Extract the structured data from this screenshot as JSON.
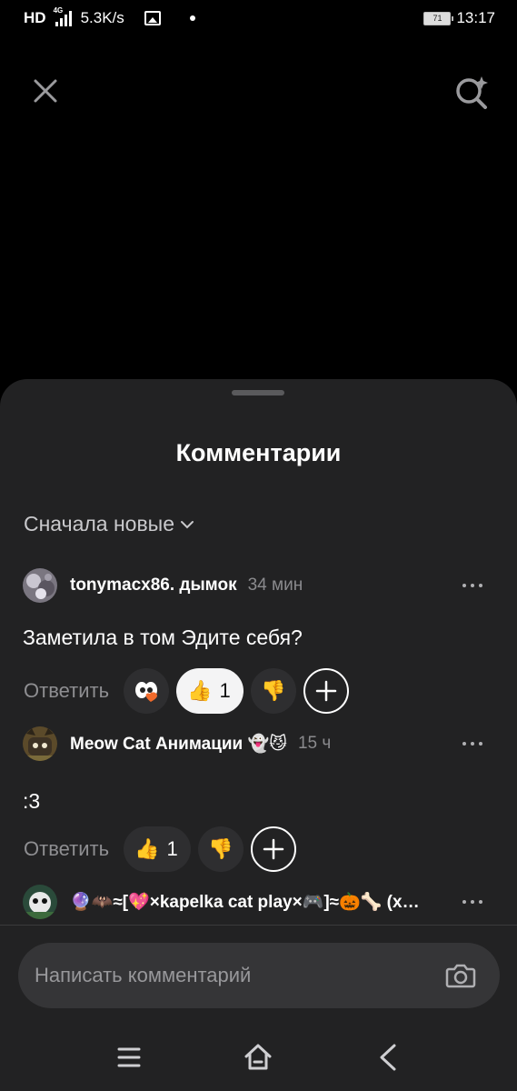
{
  "status_bar": {
    "network_label": "HD",
    "network_type": "4G",
    "speed": "5.3K/s",
    "battery": "71",
    "time": "13:17"
  },
  "top_bar": {
    "close_icon": "close-icon",
    "search_icon": "sparkle-search-icon"
  },
  "sheet": {
    "title": "Комментарии",
    "sort_label": "Сначала новые",
    "comments": [
      {
        "author": "tonymacx86. дымок",
        "time": "34 мин",
        "text": "Заметила в том Эдите себя?",
        "reply_label": "Ответить",
        "reactions": [
          {
            "emoji": "eyes-heart",
            "count": ""
          },
          {
            "emoji": "👍",
            "count": "1",
            "active": true
          },
          {
            "emoji": "👎",
            "count": ""
          }
        ]
      },
      {
        "author": "Meow Cat Анимации 👻😼",
        "time": "15 ч",
        "text": ":3",
        "reply_label": "Ответить",
        "reactions": [
          {
            "emoji": "👍",
            "count": "1"
          },
          {
            "emoji": "👎",
            "count": ""
          }
        ]
      },
      {
        "author": "🔮🦇≈[💖×kapelka cat play×🎮]≈🎃🦴 (x…"
      }
    ],
    "input_placeholder": "Написать комментарий"
  },
  "colors": {
    "background": "#000000",
    "sheet": "#222223",
    "pill": "#2e2e30",
    "pill_active": "#f4f4f5",
    "muted_text": "#8e8e91"
  }
}
